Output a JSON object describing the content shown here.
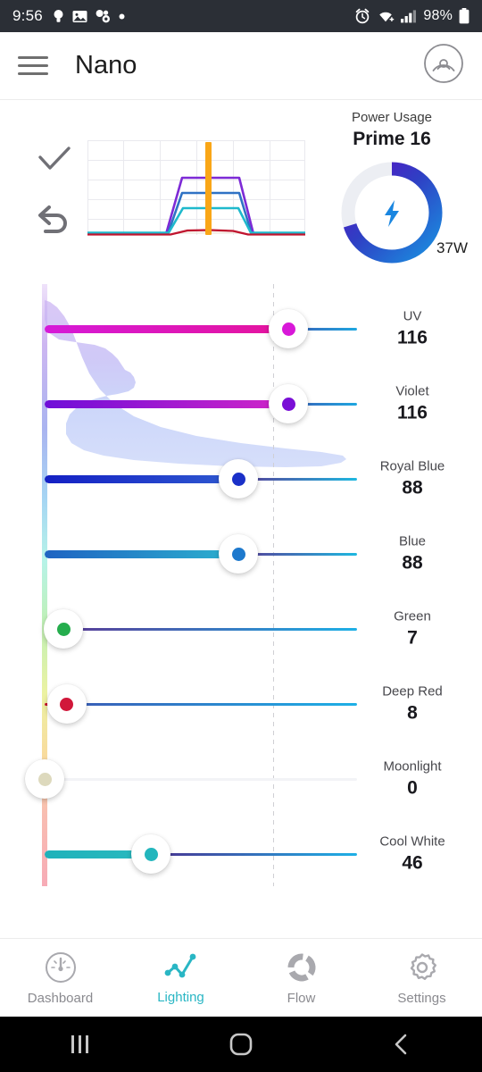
{
  "statusbar": {
    "time": "9:56",
    "battery_text": "98%",
    "icons": [
      "bulb-icon",
      "image-icon",
      "apps-icon",
      "dot-icon",
      "alarm-icon",
      "wifi-icon",
      "signal-icon",
      "battery-icon"
    ]
  },
  "appbar": {
    "title": "Nano",
    "menu_icon": "hamburger-icon",
    "broadcast_icon": "broadcast-icon"
  },
  "preview": {
    "confirm_icon": "check-icon",
    "undo_icon": "undo-icon"
  },
  "power": {
    "label": "Power Usage",
    "value": "Prime 16",
    "watt": "37W",
    "percent": 70,
    "bolt_icon": "bolt-icon",
    "gradient_start": "#5b0fc4",
    "gradient_end": "#1a8fe0",
    "track_color": "#eceef3"
  },
  "channels": [
    {
      "name": "UV",
      "value": "116",
      "percent": 78,
      "color": "#d818d8",
      "fill_start": "#d51ad8",
      "fill_end": "#e5149c",
      "rest_start": "#3b5bb5",
      "rest_end": "#1ea7e0"
    },
    {
      "name": "Violet",
      "value": "116",
      "percent": 78,
      "color": "#7a0fd6",
      "fill_start": "#6f0ed8",
      "fill_end": "#d225c8",
      "rest_start": "#3b5bb5",
      "rest_end": "#1ea7e0"
    },
    {
      "name": "Royal Blue",
      "value": "88",
      "percent": 62,
      "color": "#1a30c8",
      "fill_start": "#1420c4",
      "fill_end": "#2f5ad0",
      "rest_start": "#5a3a96",
      "rest_end": "#1eb8e0"
    },
    {
      "name": "Blue",
      "value": "88",
      "percent": 62,
      "color": "#1d79cd",
      "fill_start": "#1f63c2",
      "fill_end": "#2cb2cf",
      "rest_start": "#5a3a96",
      "rest_end": "#1eb8e0"
    },
    {
      "name": "Green",
      "value": "7",
      "percent": 6,
      "color": "#25ad4d",
      "fill_start": "#2bb152",
      "fill_end": "#2eb45a",
      "rest_start": "#5a3a96",
      "rest_end": "#1eb0e6"
    },
    {
      "name": "Deep Red",
      "value": "8",
      "percent": 7,
      "color": "#d1173a",
      "fill_start": "#c8152f",
      "fill_end": "#c8152f",
      "rest_start": "#3b5bb5",
      "rest_end": "#1eb0e6"
    },
    {
      "name": "Moonlight",
      "value": "0",
      "percent": 0,
      "color": "#ddd9bd",
      "fill_start": "#dcd8bb",
      "fill_end": "#dcd8bb",
      "rest_start": "#f2f3f6",
      "rest_end": "#f2f3f6"
    },
    {
      "name": "Cool White",
      "value": "46",
      "percent": 34,
      "color": "#23b6bd",
      "fill_start": "#1fb2ba",
      "fill_end": "#2ab9bf",
      "rest_start": "#4a3190",
      "rest_end": "#1eb0e6"
    }
  ],
  "bottomnav": {
    "items": [
      {
        "label": "Dashboard",
        "icon": "dashboard-icon",
        "active": false
      },
      {
        "label": "Lighting",
        "icon": "lighting-icon",
        "active": true
      },
      {
        "label": "Flow",
        "icon": "flow-icon",
        "active": false
      },
      {
        "label": "Settings",
        "icon": "settings-icon",
        "active": false
      }
    ],
    "active_color": "#29b6c4"
  },
  "androidnav": {
    "recents_icon": "recents-icon",
    "home_icon": "home-icon",
    "back_icon": "back-icon"
  },
  "chart_data": {
    "type": "line",
    "title": "",
    "xlabel": "",
    "ylabel": "",
    "grid": true,
    "marker_x": 0.555,
    "marker_color": "#f9a617",
    "series": [
      {
        "name": "Violet/UV",
        "color": "#7d2ad6",
        "points": [
          [
            0,
            0
          ],
          [
            0.36,
            0
          ],
          [
            0.44,
            0.6
          ],
          [
            0.56,
            0.6
          ],
          [
            0.7,
            0.6
          ],
          [
            0.76,
            0
          ],
          [
            1,
            0
          ]
        ]
      },
      {
        "name": "Royal Blue",
        "color": "#2f72c4",
        "points": [
          [
            0,
            0
          ],
          [
            0.36,
            0
          ],
          [
            0.45,
            0.44
          ],
          [
            0.56,
            0.44
          ],
          [
            0.7,
            0.44
          ],
          [
            0.76,
            0
          ],
          [
            1,
            0
          ]
        ]
      },
      {
        "name": "Cool White",
        "color": "#1fb9cc",
        "points": [
          [
            0,
            0.02
          ],
          [
            0.36,
            0.02
          ],
          [
            0.45,
            0.26
          ],
          [
            0.56,
            0.26
          ],
          [
            0.7,
            0.26
          ],
          [
            0.76,
            0.02
          ],
          [
            1,
            0.02
          ]
        ]
      },
      {
        "name": "Deep Red",
        "color": "#c0152f",
        "points": [
          [
            0,
            0
          ],
          [
            0.38,
            0
          ],
          [
            0.48,
            0.05
          ],
          [
            0.56,
            0.06
          ],
          [
            0.66,
            0.05
          ],
          [
            0.76,
            0
          ],
          [
            1,
            0
          ]
        ]
      }
    ]
  },
  "spectrum": {
    "strip_stops": [
      "#e9d8f7",
      "#c9b4ef",
      "#a9b6f0",
      "#9fd6f2",
      "#b4f2e6",
      "#bdf0b6",
      "#e8f0a0",
      "#f6d79a",
      "#f7b9ae",
      "#f6a9b4"
    ],
    "curve_fill_top": "#c4aef0",
    "curve_fill_bottom": "#b7c4f5"
  }
}
